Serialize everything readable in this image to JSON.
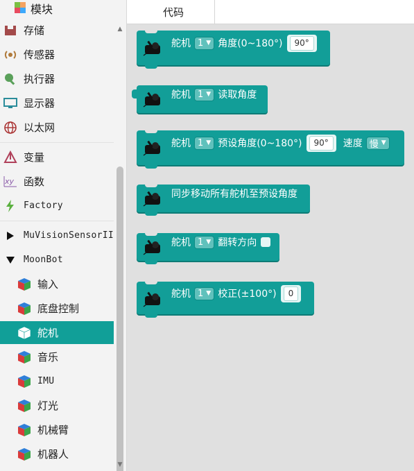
{
  "sidebar": {
    "top_item": "模块",
    "items": [
      {
        "label": "存储",
        "icon": "storage-icon"
      },
      {
        "label": "传感器",
        "icon": "sensor-icon"
      },
      {
        "label": "执行器",
        "icon": "actuator-icon"
      },
      {
        "label": "显示器",
        "icon": "display-icon"
      },
      {
        "label": "以太网",
        "icon": "ethernet-icon"
      },
      {
        "label": "变量",
        "icon": "variable-icon"
      },
      {
        "label": "函数",
        "icon": "function-icon"
      },
      {
        "label": "Factory",
        "icon": "factory-icon"
      },
      {
        "label": "MuVisionSensorII",
        "icon": "expand-arrow-icon"
      },
      {
        "label": "MoonBot",
        "icon": "collapse-arrow-icon"
      }
    ],
    "moonbot_children": [
      {
        "label": "输入"
      },
      {
        "label": "底盘控制"
      },
      {
        "label": "舵机",
        "active": true
      },
      {
        "label": "音乐"
      },
      {
        "label": "IMU"
      },
      {
        "label": "灯光"
      },
      {
        "label": "机械臂"
      },
      {
        "label": "机器人"
      }
    ]
  },
  "tabs": {
    "code": "代码"
  },
  "blocks": {
    "b1": {
      "servo": "舵机",
      "port": "1",
      "label": "角度(0~180°)",
      "value": "90°"
    },
    "b2": {
      "servo": "舵机",
      "port": "1",
      "label": "读取角度"
    },
    "b3": {
      "servo": "舵机",
      "port": "1",
      "label": "预设角度(0~180°)",
      "value": "90°",
      "speed_label": "速度",
      "speed": "慢"
    },
    "b4": {
      "label": "同步移动所有舵机至预设角度"
    },
    "b5": {
      "servo": "舵机",
      "port": "1",
      "label": "翻转方向"
    },
    "b6": {
      "servo": "舵机",
      "port": "1",
      "label": "校正(±100°)",
      "value": "0"
    }
  },
  "colors": {
    "block": "#129e98",
    "active_item": "#119f98",
    "workspace": "#e0e0e0"
  }
}
